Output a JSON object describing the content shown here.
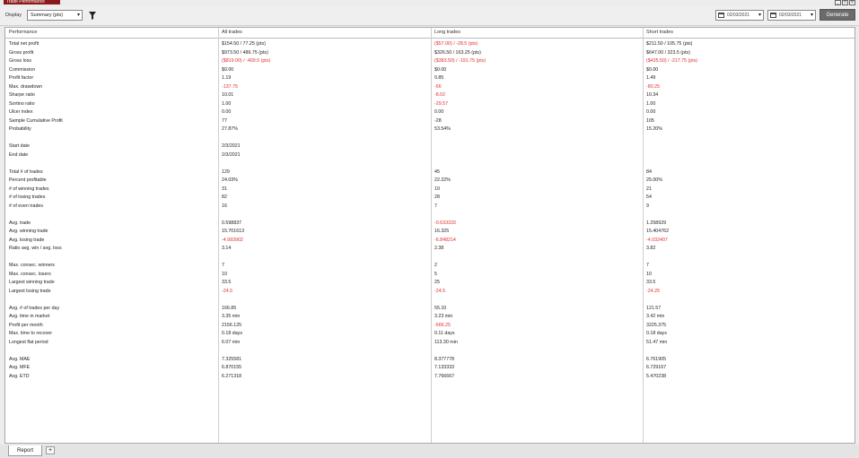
{
  "window": {
    "title": "Trade Performance",
    "controls": [
      "minimize-icon",
      "restore-icon",
      "close-icon"
    ]
  },
  "toolbar": {
    "display_label": "Display",
    "display_value": "Summary (pts)",
    "filter_icon": "filter-icon",
    "date_from": "02/03/2021",
    "date_to": "02/03/2021",
    "calendar_icon": "calendar-icon",
    "generate_label": "Generate"
  },
  "columns": [
    "Performance",
    "All trades",
    "Long trades",
    "Short trades"
  ],
  "colors": {
    "negative": "#e03030",
    "accent": "#8b1a1a"
  },
  "rows": [
    {
      "label": "Total net profit",
      "all": "$154.50 / 77.25 (pts)",
      "long": "($57.00) / -28.5 (pts)",
      "short": "$211.50 / 105.75 (pts)",
      "neg": [
        false,
        true,
        false
      ]
    },
    {
      "label": "Gross profit",
      "all": "$973.50 / 486.75 (pts)",
      "long": "$326.50 / 163.25 (pts)",
      "short": "$647.00 / 323.5 (pts)",
      "neg": [
        false,
        false,
        false
      ]
    },
    {
      "label": "Gross loss",
      "all": "($819.00) / -409.5 (pts)",
      "long": "($383.50) / -191.75 (pts)",
      "short": "($435.50) / -217.75 (pts)",
      "neg": [
        true,
        true,
        true
      ]
    },
    {
      "label": "Commission",
      "all": "$0.00",
      "long": "$0.00",
      "short": "$0.00",
      "neg": [
        false,
        false,
        false
      ]
    },
    {
      "label": "Profit factor",
      "all": "1.19",
      "long": "0.85",
      "short": "1.49",
      "neg": [
        false,
        false,
        false
      ]
    },
    {
      "label": "Max. drawdown",
      "all": "-137.75",
      "long": "-66",
      "short": "-80.25",
      "neg": [
        true,
        true,
        true
      ]
    },
    {
      "label": "Sharpe ratio",
      "all": "10.01",
      "long": "-8.02",
      "short": "10.34",
      "neg": [
        false,
        true,
        false
      ]
    },
    {
      "label": "Sortino ratio",
      "all": "1.00",
      "long": "-29.57",
      "short": "1.00",
      "neg": [
        false,
        true,
        false
      ]
    },
    {
      "label": "Ulcer index",
      "all": "0.00",
      "long": "0.00",
      "short": "0.00",
      "neg": [
        false,
        false,
        false
      ]
    },
    {
      "label": "Sample Cumulative Profit",
      "all": "77",
      "long": "-28",
      "short": "105",
      "neg": [
        false,
        false,
        false
      ]
    },
    {
      "label": "Probability",
      "all": "27.87%",
      "long": "53.54%",
      "short": "15.20%",
      "neg": [
        false,
        false,
        false
      ]
    },
    {
      "label": "",
      "all": "",
      "long": "",
      "short": "",
      "neg": [
        false,
        false,
        false
      ]
    },
    {
      "label": "Start date",
      "all": "2/3/2021",
      "long": "",
      "short": "",
      "neg": [
        false,
        false,
        false
      ]
    },
    {
      "label": "End date",
      "all": "2/3/2021",
      "long": "",
      "short": "",
      "neg": [
        false,
        false,
        false
      ]
    },
    {
      "label": "",
      "all": "",
      "long": "",
      "short": "",
      "neg": [
        false,
        false,
        false
      ]
    },
    {
      "label": "Total # of trades",
      "all": "129",
      "long": "45",
      "short": "84",
      "neg": [
        false,
        false,
        false
      ]
    },
    {
      "label": "Percent profitable",
      "all": "24.03%",
      "long": "22.22%",
      "short": "25.00%",
      "neg": [
        false,
        false,
        false
      ]
    },
    {
      "label": "# of winning trades",
      "all": "31",
      "long": "10",
      "short": "21",
      "neg": [
        false,
        false,
        false
      ]
    },
    {
      "label": "# of losing trades",
      "all": "82",
      "long": "28",
      "short": "54",
      "neg": [
        false,
        false,
        false
      ]
    },
    {
      "label": "# of even trades",
      "all": "16",
      "long": "7",
      "short": "9",
      "neg": [
        false,
        false,
        false
      ]
    },
    {
      "label": "",
      "all": "",
      "long": "",
      "short": "",
      "neg": [
        false,
        false,
        false
      ]
    },
    {
      "label": "Avg. trade",
      "all": "0.598837",
      "long": "-0.633333",
      "short": "1.258929",
      "neg": [
        false,
        true,
        false
      ]
    },
    {
      "label": "Avg. winning trade",
      "all": "15.701613",
      "long": "16.325",
      "short": "15.404762",
      "neg": [
        false,
        false,
        false
      ]
    },
    {
      "label": "Avg. losing trade",
      "all": "-4.993902",
      "long": "-6.848214",
      "short": "-4.032407",
      "neg": [
        true,
        true,
        true
      ]
    },
    {
      "label": "Ratio avg. win / avg. loss",
      "all": "3.14",
      "long": "2.38",
      "short": "3.82",
      "neg": [
        false,
        false,
        false
      ]
    },
    {
      "label": "",
      "all": "",
      "long": "",
      "short": "",
      "neg": [
        false,
        false,
        false
      ]
    },
    {
      "label": "Max. consec. winners",
      "all": "7",
      "long": "2",
      "short": "7",
      "neg": [
        false,
        false,
        false
      ]
    },
    {
      "label": "Max. consec. losers",
      "all": "10",
      "long": "5",
      "short": "10",
      "neg": [
        false,
        false,
        false
      ]
    },
    {
      "label": "Largest winning trade",
      "all": "33.5",
      "long": "25",
      "short": "33.5",
      "neg": [
        false,
        false,
        false
      ]
    },
    {
      "label": "Largest losing trade",
      "all": "-24.5",
      "long": "-24.5",
      "short": "-24.25",
      "neg": [
        true,
        true,
        true
      ]
    },
    {
      "label": "",
      "all": "",
      "long": "",
      "short": "",
      "neg": [
        false,
        false,
        false
      ]
    },
    {
      "label": "Avg. # of trades per day",
      "all": "166.85",
      "long": "55.10",
      "short": "121.57",
      "neg": [
        false,
        false,
        false
      ]
    },
    {
      "label": "Avg. time in market",
      "all": "3.35 min",
      "long": "3.23 min",
      "short": "3.42 min",
      "neg": [
        false,
        false,
        false
      ]
    },
    {
      "label": "Profit per month",
      "all": "2156.125",
      "long": "-666.25",
      "short": "3225.375",
      "neg": [
        false,
        true,
        false
      ]
    },
    {
      "label": "Max. time to recover",
      "all": "0.18 days",
      "long": "0.11 days",
      "short": "0.18 days",
      "neg": [
        false,
        false,
        false
      ]
    },
    {
      "label": "Longest flat period",
      "all": "6.07 min",
      "long": "113.30 min",
      "short": "51.47 min",
      "neg": [
        false,
        false,
        false
      ]
    },
    {
      "label": "",
      "all": "",
      "long": "",
      "short": "",
      "neg": [
        false,
        false,
        false
      ]
    },
    {
      "label": "Avg. MAE",
      "all": "7.325581",
      "long": "8.377778",
      "short": "6.761905",
      "neg": [
        false,
        false,
        false
      ]
    },
    {
      "label": "Avg. MFE",
      "all": "6.870155",
      "long": "7.133333",
      "short": "6.729167",
      "neg": [
        false,
        false,
        false
      ]
    },
    {
      "label": "Avg. ETD",
      "all": "6.271318",
      "long": "7.766667",
      "short": "5.470238",
      "neg": [
        false,
        false,
        false
      ]
    }
  ],
  "bottom_tabs": {
    "report_label": "Report",
    "add_label": "+"
  }
}
